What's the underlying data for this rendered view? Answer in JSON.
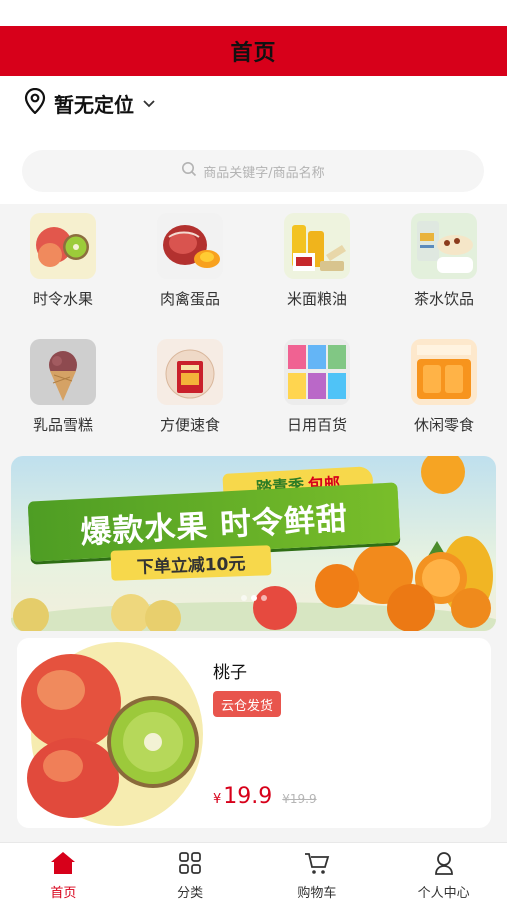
{
  "header": {
    "title": "首页"
  },
  "location": {
    "label": "暂无定位"
  },
  "search": {
    "placeholder": "商品关键字/商品名称"
  },
  "categories": [
    {
      "label": "时令水果",
      "icon": "fruit-image"
    },
    {
      "label": "肉禽蛋品",
      "icon": "meat-egg-image"
    },
    {
      "label": "米面粮油",
      "icon": "grain-oil-image"
    },
    {
      "label": "茶水饮品",
      "icon": "tea-drink-image"
    },
    {
      "label": "乳品雪糕",
      "icon": "ice-cream-image"
    },
    {
      "label": "方便速食",
      "icon": "instant-food-image"
    },
    {
      "label": "日用百货",
      "icon": "daily-goods-image"
    },
    {
      "label": "休闲零食",
      "icon": "snack-image"
    }
  ],
  "banner": {
    "tag_prefix": "踏青季",
    "tag_highlight": "包邮",
    "headline": "爆款水果 时令鲜甜",
    "subline": "下单立减10元",
    "slide_count": 3,
    "active_slide": 1
  },
  "product": {
    "name": "桃子",
    "tag": "云仓发货",
    "currency": "¥",
    "price": "19.9",
    "original_price": "¥19.9"
  },
  "tabs": [
    {
      "label": "首页",
      "icon": "home-icon",
      "active": true
    },
    {
      "label": "分类",
      "icon": "category-grid-icon",
      "active": false
    },
    {
      "label": "购物车",
      "icon": "cart-icon",
      "active": false
    },
    {
      "label": "个人中心",
      "icon": "user-icon",
      "active": false
    }
  ],
  "colors": {
    "brand_red": "#d7001a",
    "tag_red": "#e8554d",
    "banner_green": "#4e9d24",
    "banner_yellow": "#f7d84b"
  }
}
